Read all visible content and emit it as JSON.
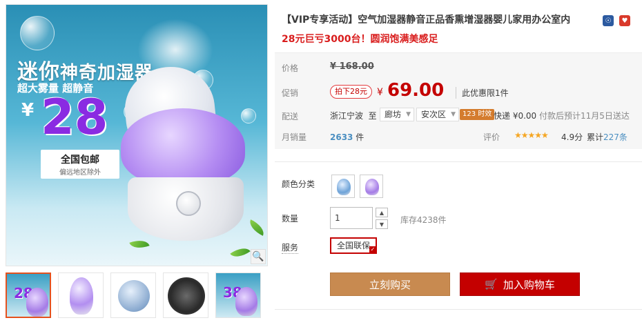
{
  "main_image": {
    "promo_title_big": "迷你",
    "promo_title": "神奇加湿器",
    "promo_sub": "超大雾量 超静音",
    "promo_yen": "¥",
    "promo_price": "28",
    "promo_ship_main": "全国包邮",
    "promo_ship_note": "偏远地区除外",
    "zoom_icon": "magnifier-icon"
  },
  "thumbnails": [
    {
      "label": "28"
    },
    {
      "label": ""
    },
    {
      "label": ""
    },
    {
      "label": ""
    },
    {
      "label": "38"
    }
  ],
  "product": {
    "title": "【VIP专享活动】空气加湿器静音正品香熏增湿器婴儿家用办公室内",
    "subtitle": "28元巨亏3000台！圆润饱满美感足"
  },
  "price": {
    "label": "价格",
    "original": "¥ 168.00",
    "promo_label": "促销",
    "promo_tag": "拍下28元",
    "currency": "¥",
    "current": "69.00",
    "limit_note": "此优惠限1件"
  },
  "shipping": {
    "label": "配送",
    "from": "浙江宁波",
    "to_word": "至",
    "city": "廊坊",
    "district": "安次区",
    "timely_badge": "123 时效",
    "express": "快递 ¥0.00",
    "eta": "付款后预计11月5日送达"
  },
  "sales": {
    "label": "月销量",
    "count": "2633",
    "unit": "件",
    "rating_label": "评价",
    "stars": "★★★★★",
    "score": "4.9分",
    "reviews_prefix": "累计",
    "reviews_count": "227条"
  },
  "options": {
    "color_label": "颜色分类",
    "qty_label": "数量",
    "qty_value": "1",
    "stock": "库存4238件",
    "service_label": "服务",
    "service_tag": "全国联保"
  },
  "actions": {
    "buy_now": "立刻购买",
    "add_cart": "加入购物车"
  },
  "colors": {
    "price_red": "#c40000",
    "buy_orange": "#c88a50",
    "link_blue": "#4b8fc1"
  }
}
